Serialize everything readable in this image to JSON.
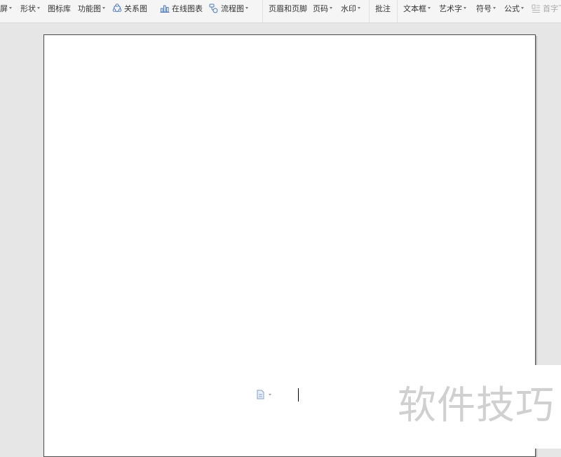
{
  "toolbar": {
    "screen_label": "屏",
    "shapes_label": "形状",
    "icon_library_label": "图标库",
    "function_chart_label": "功能图",
    "relation_chart_label": "关系图",
    "online_chart_label": "在线图表",
    "flowchart_label": "流程图",
    "header_footer_label": "页眉和页脚",
    "page_number_label": "页码",
    "watermark_label": "水印",
    "comment_label": "批注",
    "text_box_label": "文本框",
    "word_art_label": "艺术字",
    "symbol_label": "符号",
    "formula_label": "公式",
    "drop_cap_label": "首字下"
  },
  "document": {
    "watermark_text": "软件技巧"
  },
  "colors": {
    "ribbon_bg": "#f5f5f5",
    "workspace_bg": "#e6e6e6",
    "page_bg": "#ffffff",
    "watermark": "#d0d0d0"
  },
  "icons": {
    "relation_chart": "relation-chart-icon",
    "online_chart": "online-chart-icon",
    "flowchart": "flowchart-icon",
    "drop_cap": "drop-cap-icon",
    "paragraph_options": "document-icon"
  }
}
